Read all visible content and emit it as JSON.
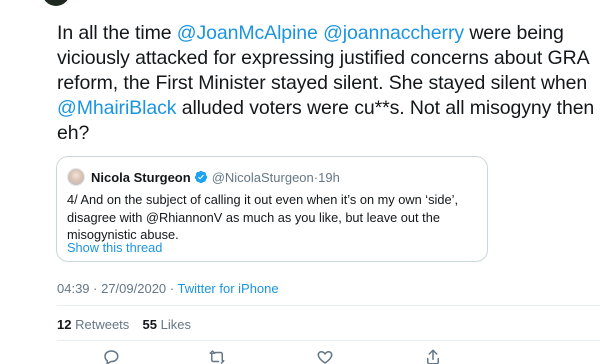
{
  "tweet": {
    "lines": [
      [
        {
          "text": "In all the time ",
          "type": "text"
        },
        {
          "text": "@JoanMcAlpine",
          "type": "mention"
        },
        {
          "text": " ",
          "type": "text"
        },
        {
          "text": "@joannaccherry",
          "type": "mention"
        },
        {
          "text": " were being",
          "type": "text"
        }
      ],
      [
        {
          "text": "viciously attacked for expressing justified concerns about GRA",
          "type": "text"
        }
      ],
      [
        {
          "text": "reform, the First Minister stayed silent. She stayed silent when",
          "type": "text"
        }
      ],
      [
        {
          "text": "@MhairiBlack",
          "type": "mention"
        },
        {
          "text": " alluded voters were cu**s. Not all misogyny then",
          "type": "text"
        }
      ],
      [
        {
          "text": "eh?",
          "type": "text"
        }
      ]
    ]
  },
  "quote": {
    "name": "Nicola Sturgeon",
    "handle": "@NicolaSturgeon",
    "separator": "·",
    "time": "19h",
    "body_lines": [
      "4/ And on the subject of calling it out even when it’s on my own ‘side’,",
      "disagree with @RhiannonV as much as  you like, but leave out the",
      "misogynistic abuse."
    ],
    "show_thread": "Show this thread"
  },
  "meta": {
    "time": "04:39 · 27/09/2020 · ",
    "source": "Twitter for iPhone"
  },
  "stats": {
    "retweets_count": "12",
    "retweets_label": "Retweets",
    "likes_count": "55",
    "likes_label": "Likes"
  },
  "actions": {
    "reply_icon": "reply-icon",
    "retweet_icon": "retweet-icon",
    "like_icon": "heart-icon",
    "share_icon": "share-icon"
  },
  "colors": {
    "link": "#1b95e0",
    "text": "#14171a",
    "secondary": "#657786",
    "border": "#ccd6dd"
  }
}
